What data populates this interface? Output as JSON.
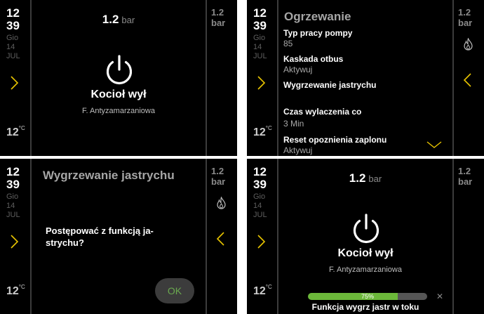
{
  "colors": {
    "accent_green": "#6cb83a",
    "ok_text": "#6aa84f",
    "background": "#000000"
  },
  "panels": [
    {
      "clock": {
        "hour": "12",
        "minute": "39"
      },
      "date": {
        "day": "Gio",
        "num": "14",
        "month": "JUL"
      },
      "temp": {
        "value": "12",
        "unit": "°C"
      },
      "right_pressure": {
        "value": "1.2",
        "unit": "bar"
      },
      "pressure": {
        "value": "1.2",
        "unit": "bar"
      },
      "status": {
        "title": "Kocioł wył",
        "subtitle": "F. Antyzamarzaniowa"
      },
      "icons": {
        "nav": "chevron-right-icon",
        "power": "power-icon"
      }
    },
    {
      "clock": {
        "hour": "12",
        "minute": "39"
      },
      "date": {
        "day": "Gio",
        "num": "14",
        "month": "JUL"
      },
      "temp": {
        "value": "12",
        "unit": "°C"
      },
      "right_pressure": {
        "value": "1.2",
        "unit": "bar"
      },
      "menu": {
        "title": "Ogrzewanie",
        "items": [
          {
            "label": "Typ pracy pompy",
            "value": "85"
          },
          {
            "label": "Kaskada otbus",
            "value": "Aktywuj"
          },
          {
            "label": "Wygrzewanie jastrychu",
            "value": ""
          },
          {
            "label": "Czas wylaczenia co",
            "value": "3 Min"
          },
          {
            "label": "Reset opoznienia zaplonu",
            "value": "Aktywuj"
          }
        ]
      },
      "icons": {
        "nav": "chevron-right-icon",
        "back": "chevron-left-icon",
        "flame": "flame-icon",
        "scroll": "chevron-down-icon"
      }
    },
    {
      "clock": {
        "hour": "12",
        "minute": "39"
      },
      "date": {
        "day": "Gio",
        "num": "14",
        "month": "JUL"
      },
      "temp": {
        "value": "12",
        "unit": "°C"
      },
      "right_pressure": {
        "value": "1.2",
        "unit": "bar"
      },
      "dialog": {
        "title": "Wygrzewanie jastrychu",
        "prompt": "Postępować z funkcją ja-strychu?",
        "ok_label": "OK"
      },
      "icons": {
        "nav": "chevron-right-icon",
        "back": "chevron-left-icon",
        "flame": "flame-icon"
      }
    },
    {
      "clock": {
        "hour": "12",
        "minute": "39"
      },
      "date": {
        "day": "Gio",
        "num": "14",
        "month": "JUL"
      },
      "temp": {
        "value": "12",
        "unit": "°C"
      },
      "right_pressure": {
        "value": "1.2",
        "unit": "bar"
      },
      "pressure": {
        "value": "1.2",
        "unit": "bar"
      },
      "status": {
        "title": "Kocioł wył",
        "subtitle": "F. Antyzamarzaniowa"
      },
      "progress": {
        "percent": 75,
        "percent_label": "75%",
        "cancel_symbol": "✕",
        "label": "Funkcja wygrz jastr w toku"
      },
      "icons": {
        "nav": "chevron-right-icon",
        "power": "power-icon"
      }
    }
  ]
}
